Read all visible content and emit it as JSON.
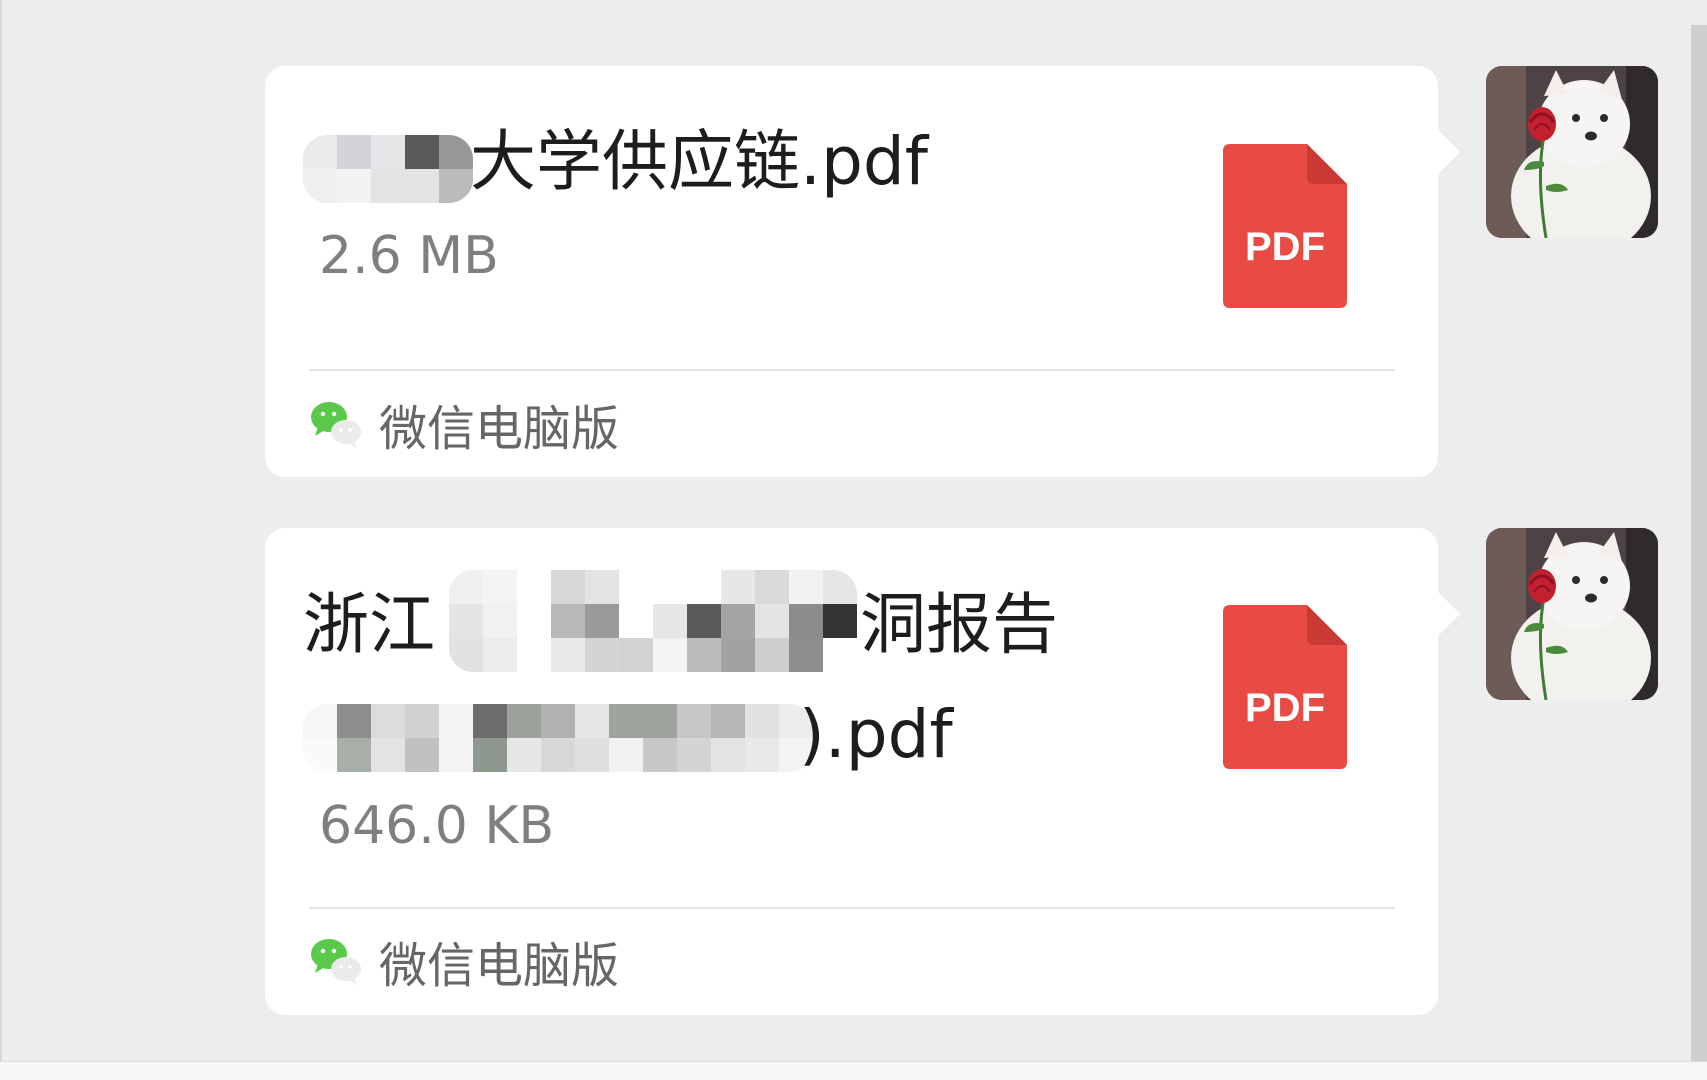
{
  "messages": [
    {
      "file_name_suffix": "大学供应链.pdf",
      "file_size": "2.6 MB",
      "file_type_label": "PDF",
      "source_label": "微信电脑版"
    },
    {
      "file_name_prefix": "浙江",
      "file_name_middle": "洞报告",
      "file_name_end": ").pdf",
      "file_size": "646.0 KB",
      "file_type_label": "PDF",
      "source_label": "微信电脑版"
    }
  ],
  "icons": {
    "file": "pdf-file-icon",
    "source": "wechat-icon",
    "avatar": "avatar-samoyed-with-rose"
  },
  "colors": {
    "pdf_red": "#e84a44",
    "bubble_bg": "#ffffff",
    "chat_bg": "#ededed",
    "wechat_green": "#5ac84b"
  }
}
